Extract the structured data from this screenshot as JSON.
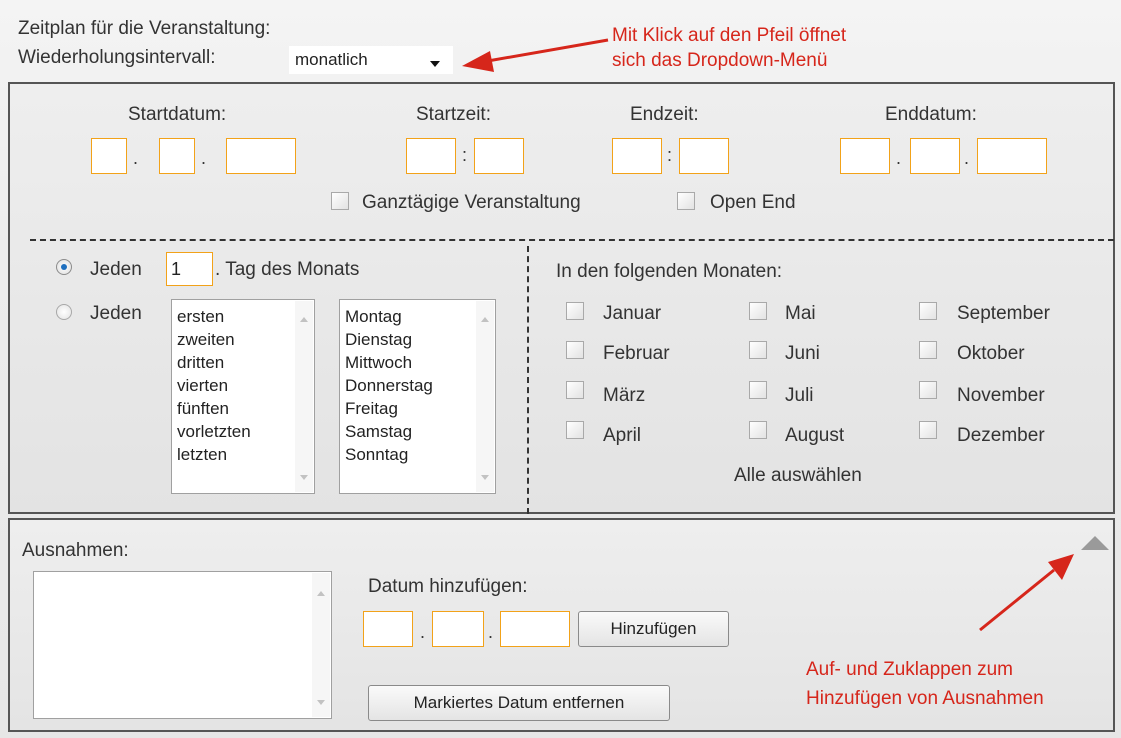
{
  "schedule": {
    "title": "Zeitplan für die Veranstaltung:",
    "interval_label": "Wiederholungsintervall:",
    "interval_value": "monatlich"
  },
  "hints": {
    "dropdown_line1": "Mit Klick auf den Pfeil öffnet",
    "dropdown_line2": "sich das Dropdown-Menü",
    "collapse_line1": "Auf- und Zuklappen zum",
    "collapse_line2": "Hinzufügen von Ausnahmen",
    "color": "#d6261b"
  },
  "datetime": {
    "start_date_label": "Startdatum:",
    "start_time_label": "Startzeit:",
    "end_time_label": "Endzeit:",
    "end_date_label": "Enddatum:",
    "date_separator": ".",
    "time_separator": ":",
    "allday_label": "Ganztägige Veranstaltung",
    "open_end_label": "Open End"
  },
  "recurrence": {
    "option1_prefix": "Jeden",
    "option1_day_value": "1",
    "option1_suffix": ". Tag des Monats",
    "option2_prefix": "Jeden",
    "selected_option": 1,
    "ordinals": [
      "ersten",
      "zweiten",
      "dritten",
      "vierten",
      "fünften",
      "vorletzten",
      "letzten"
    ],
    "weekdays": [
      "Montag",
      "Dienstag",
      "Mittwoch",
      "Donnerstag",
      "Freitag",
      "Samstag",
      "Sonntag"
    ]
  },
  "months": {
    "heading": "In den folgenden Monaten:",
    "items": [
      "Januar",
      "Februar",
      "März",
      "April",
      "Mai",
      "Juni",
      "Juli",
      "August",
      "September",
      "Oktober",
      "November",
      "Dezember"
    ],
    "select_all": "Alle auswählen"
  },
  "exceptions": {
    "heading": "Ausnahmen:",
    "add_date_label": "Datum hinzufügen:",
    "add_button": "Hinzufügen",
    "remove_button": "Markiertes Datum entfernen"
  },
  "colors": {
    "input_border": "#f2a219",
    "radio_selected": "#1e6fbf"
  }
}
